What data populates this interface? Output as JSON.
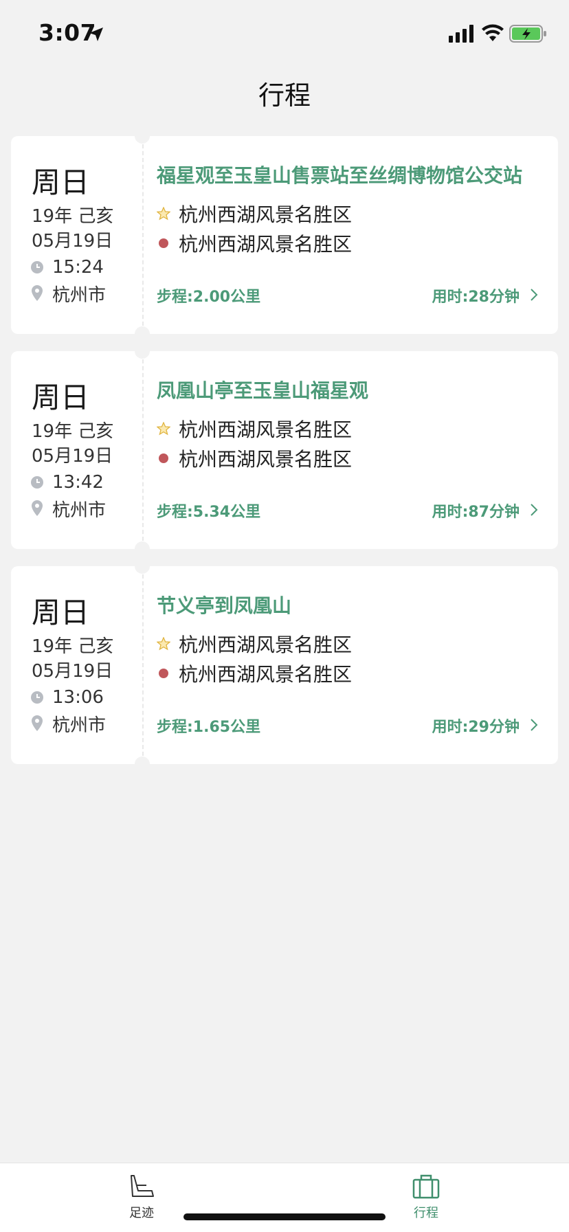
{
  "status_bar": {
    "time": "3:07",
    "icons": [
      "location-arrow-icon",
      "cellular-signal-icon",
      "wifi-icon",
      "battery-charging-icon"
    ]
  },
  "header": {
    "title": "行程"
  },
  "trips": [
    {
      "weekday": "周日",
      "date_line1": "19年 己亥",
      "date_line2": "05月19日",
      "time": "15:24",
      "city": "杭州市",
      "route_title": "福星观至玉皇山售票站至丝绸博物馆公交站",
      "start": "杭州西湖风景名胜区",
      "end": "杭州西湖风景名胜区",
      "distance": "步程:2.00公里",
      "duration": "用时:28分钟"
    },
    {
      "weekday": "周日",
      "date_line1": "19年 己亥",
      "date_line2": "05月19日",
      "time": "13:42",
      "city": "杭州市",
      "route_title": "凤凰山亭至玉皇山福星观",
      "start": "杭州西湖风景名胜区",
      "end": "杭州西湖风景名胜区",
      "distance": "步程:5.34公里",
      "duration": "用时:87分钟"
    },
    {
      "weekday": "周日",
      "date_line1": "19年 己亥",
      "date_line2": "05月19日",
      "time": "13:06",
      "city": "杭州市",
      "route_title": "节义亭到凤凰山",
      "start": "杭州西湖风景名胜区",
      "end": "杭州西湖风景名胜区",
      "distance": "步程:1.65公里",
      "duration": "用时:29分钟"
    }
  ],
  "tab_bar": {
    "items": [
      {
        "label": "足迹",
        "icon": "footprint-seat-icon",
        "active": false
      },
      {
        "label": "行程",
        "icon": "itinerary-suitcase-icon",
        "active": true
      }
    ]
  },
  "colors": {
    "accent": "#4c9a78",
    "background": "#f2f2f2",
    "end_dot": "#c0575b",
    "start_star": "#f2c94c"
  }
}
